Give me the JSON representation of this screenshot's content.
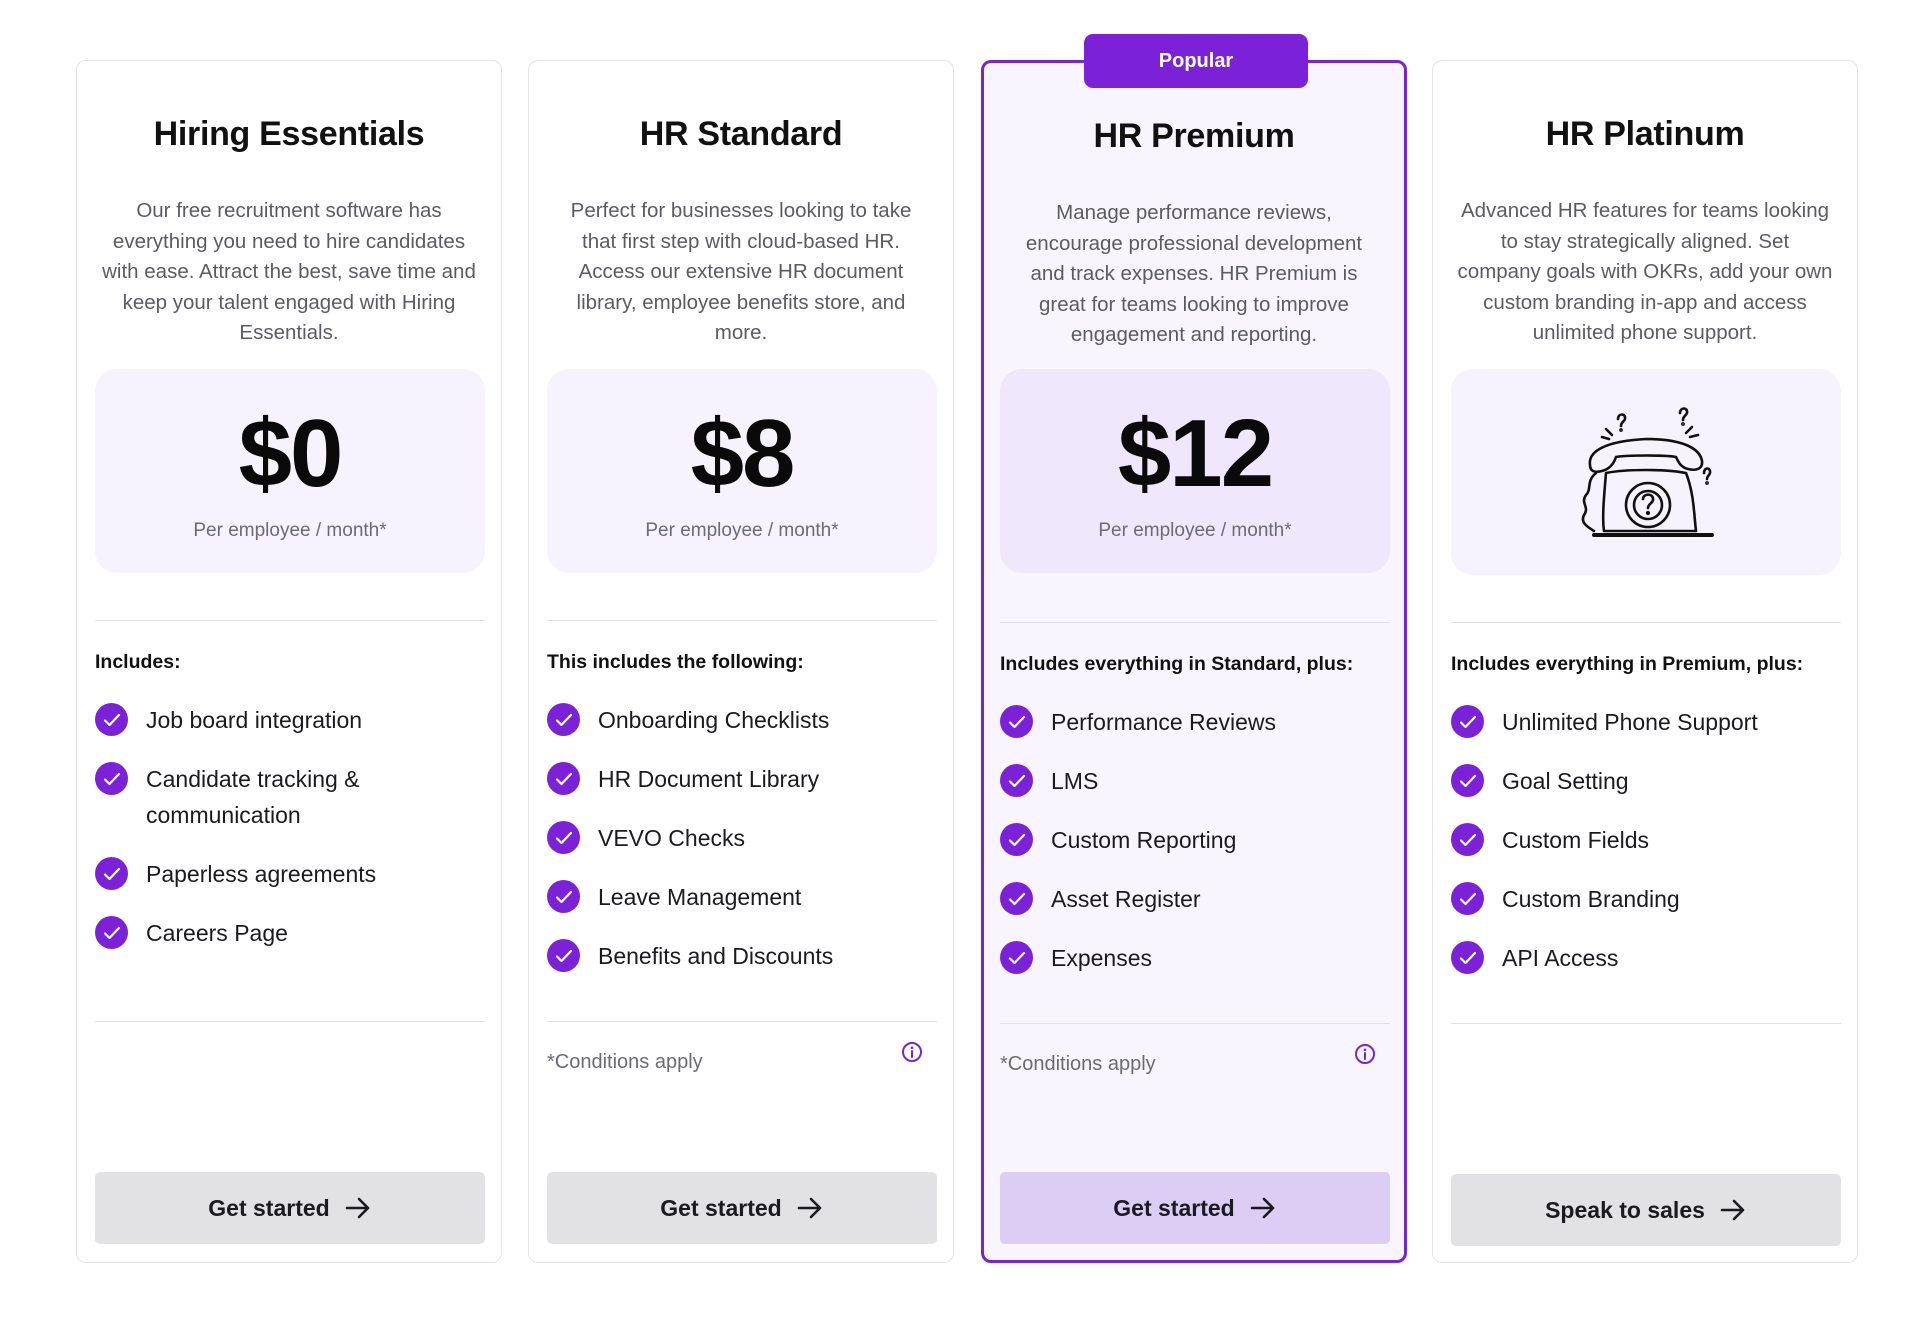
{
  "plans": [
    {
      "title": "Hiring Essentials",
      "description": "Our free recruitment software has everything you need to hire candidates with ease. Attract the best, save time and keep your talent engaged with Hiring Essentials.",
      "price": "$0",
      "per": "Per employee / month*",
      "includes": "Includes:",
      "features": [
        "Job board integration",
        "Candidate tracking & communication",
        "Paperless agreements",
        "Careers Page"
      ],
      "cta": "Get started"
    },
    {
      "title": "HR Standard",
      "description": "Perfect for businesses looking to take that first step with cloud-based HR. Access our extensive HR document library, employee benefits store, and more.",
      "price": "$8",
      "per": "Per employee / month*",
      "includes": "This includes the following:",
      "features": [
        "Onboarding Checklists",
        "HR Document Library",
        "VEVO Checks",
        "Leave Management",
        "Benefits and Discounts"
      ],
      "conditions": "*Conditions apply",
      "cta": "Get started"
    },
    {
      "badge": "Popular",
      "title": "HR Premium",
      "description": "Manage performance reviews, encourage professional development and track expenses. HR Premium is great for teams looking to improve engagement and reporting.",
      "price": "$12",
      "per": "Per employee / month*",
      "includes": "Includes everything in Standard, plus:",
      "features": [
        "Performance Reviews",
        "LMS",
        "Custom Reporting",
        "Asset Register",
        "Expenses"
      ],
      "conditions": "*Conditions apply",
      "cta": "Get started"
    },
    {
      "title": "HR Platinum",
      "description": "Advanced HR features for teams looking to stay strategically aligned. Set company goals with OKRs, add your own custom branding in-app and access unlimited phone support.",
      "illustration": "telephone-question-icon",
      "includes": "Includes everything in Premium, plus:",
      "features": [
        "Unlimited Phone Support",
        "Goal Setting",
        "Custom Fields",
        "Custom Branding",
        "API Access"
      ],
      "cta": "Speak to sales"
    }
  ],
  "colors": {
    "accent": "#7b22d9",
    "price_bg": "#f6f3fe",
    "popular_bg": "#f8f5fe",
    "button_bg": "#e2e2e4",
    "popular_button_bg": "#dccdf4"
  },
  "icons": {
    "feature": "check-circle-icon",
    "info": "info-icon",
    "cta": "arrow-right-icon"
  }
}
